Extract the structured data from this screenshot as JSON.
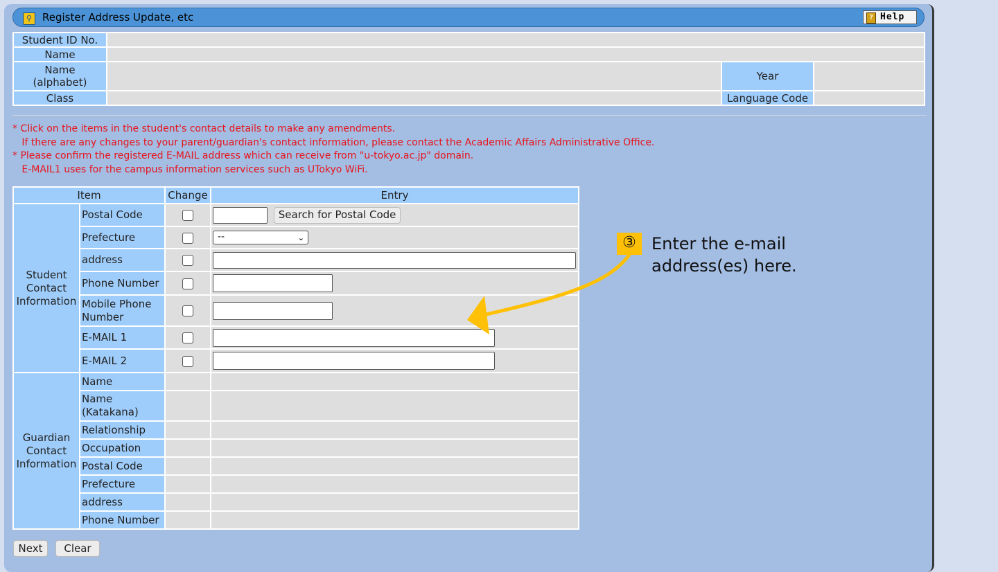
{
  "window": {
    "title": "Register Address Update, etc",
    "help_label": "Help"
  },
  "student_info": {
    "student_id_label": "Student ID No.",
    "name_label": "Name",
    "name_alpha_label_1": "Name",
    "name_alpha_label_2": "(alphabet)",
    "year_label": "Year",
    "class_label": "Class",
    "language_code_label": "Language Code"
  },
  "notes": [
    "* Click on the items in the student's contact details to make any amendments.",
    "   If there are any changes to your parent/guardian's contact information, please contact the Academic Affairs Administrative Office.",
    "* Please confirm the registered E-MAIL address which can receive from \"u-tokyo.ac.jp\" domain.",
    "   E-MAIL1 uses for the campus information services such as UTokyo WiFi."
  ],
  "table": {
    "headers": {
      "item": "Item",
      "change": "Change",
      "entry": "Entry"
    },
    "student_group": [
      "Student",
      "Contact",
      "Information"
    ],
    "guardian_group": [
      "Guardian",
      "Contact",
      "Information"
    ],
    "student_items": {
      "postal_code": "Postal Code",
      "prefecture": "Prefecture",
      "address": "address",
      "phone": "Phone Number",
      "mobile_1": "Mobile Phone",
      "mobile_2": "Number",
      "email1": "E-MAIL 1",
      "email2": "E-MAIL 2"
    },
    "guardian_items": {
      "name": "Name",
      "name_kana_1": "Name",
      "name_kana_2": "(Katakana)",
      "relationship": "Relationship",
      "occupation": "Occupation",
      "postal_code": "Postal Code",
      "prefecture": "Prefecture",
      "address": "address",
      "phone": "Phone Number"
    },
    "search_postal_button": "Search for Postal Code",
    "prefecture_selected": "--"
  },
  "buttons": {
    "next": "Next",
    "clear": "Clear"
  },
  "annotation": {
    "number": "③",
    "line1": "Enter the e-mail",
    "line2": "address(es) here.",
    "color": "#ffc107"
  }
}
